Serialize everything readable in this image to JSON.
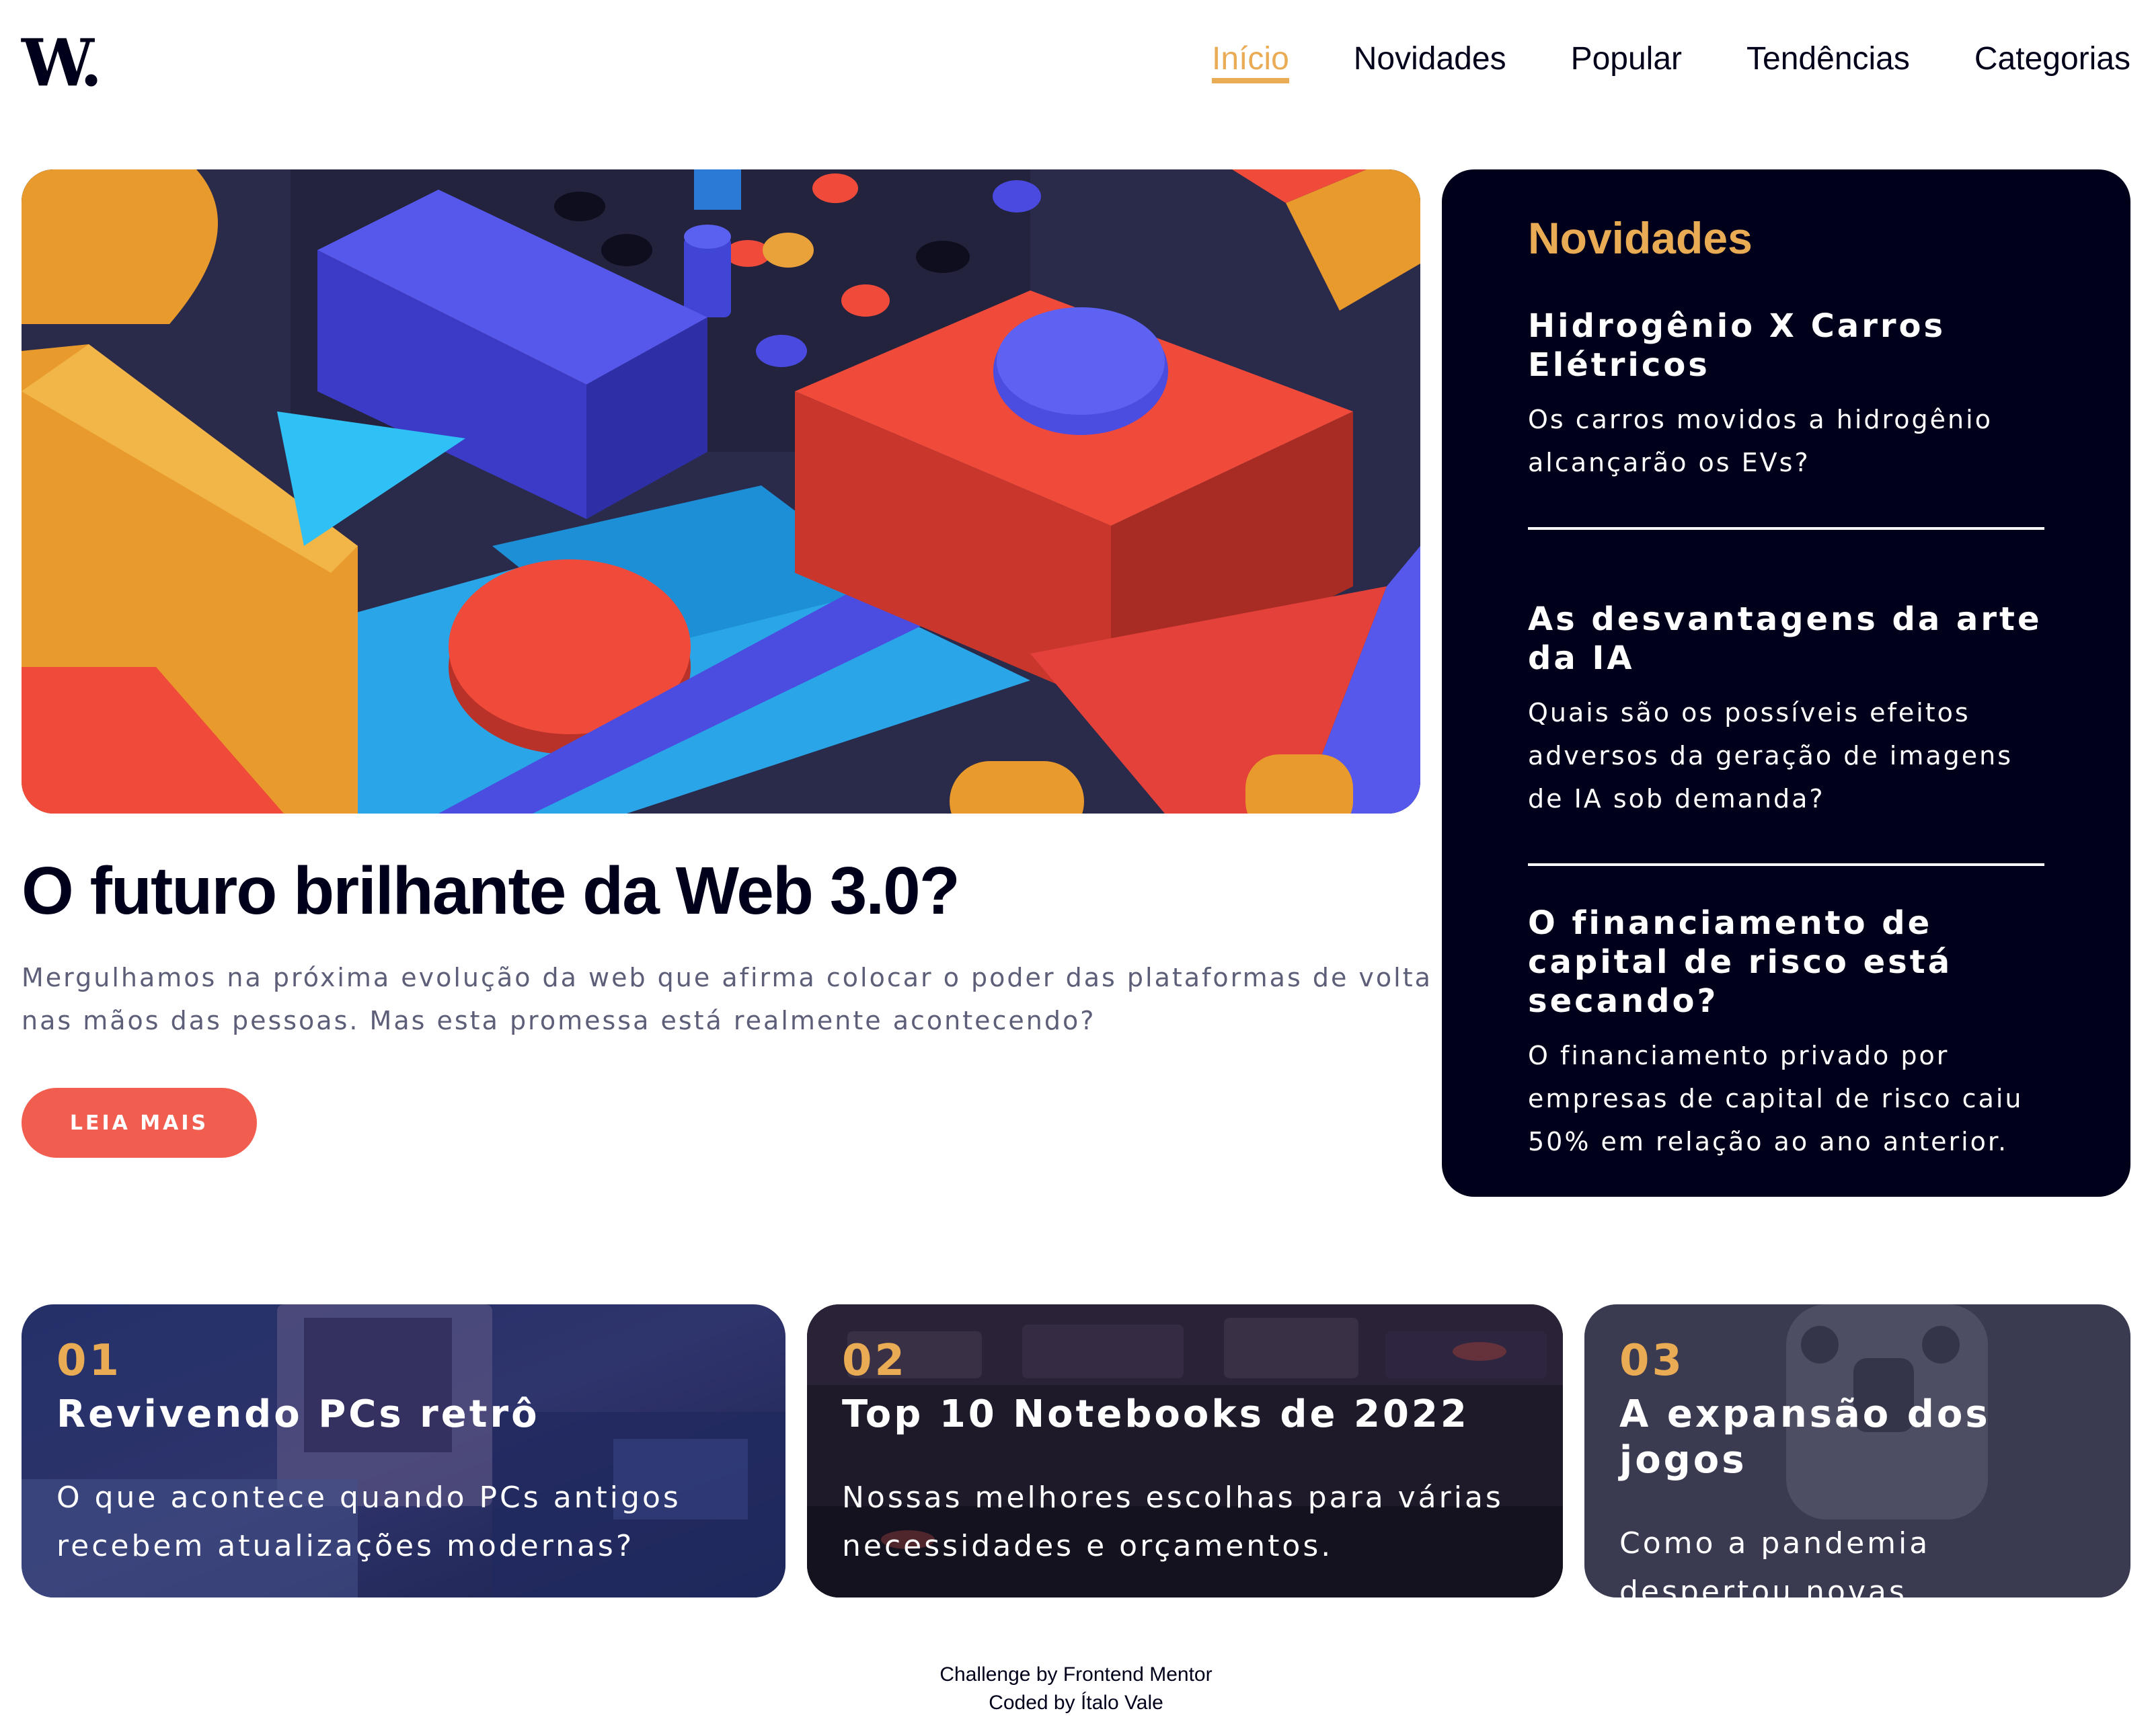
{
  "header": {
    "logo": "W.",
    "nav": [
      {
        "label": "Início",
        "active": true
      },
      {
        "label": "Novidades",
        "active": false
      },
      {
        "label": "Popular",
        "active": false
      },
      {
        "label": "Tendências",
        "active": false
      },
      {
        "label": "Categorias",
        "active": false
      }
    ]
  },
  "hero": {
    "image_subject": "abstract 3D geometric blocks",
    "title": "O futuro brilhante da Web 3.0?",
    "description": "Mergulhamos na próxima evolução da web que afirma colocar o poder das plataformas de volta nas mãos das pessoas. Mas esta promessa está realmente acontecendo?",
    "cta_label": "LEIA MAIS"
  },
  "new_panel": {
    "heading": "Novidades",
    "items": [
      {
        "title": "Hidrogênio X Carros Elétricos",
        "text": "Os carros movidos a hidrogênio alcançarão os EVs?"
      },
      {
        "title": "As desvantagens da arte da IA",
        "text": "Quais são os possíveis efeitos adversos da geração de imagens de IA sob demanda?"
      },
      {
        "title": "O financiamento de capital de risco está secando?",
        "text": "O financiamento privado por empresas de capital de risco caiu 50% em relação ao ano anterior."
      }
    ]
  },
  "cards": [
    {
      "number": "01",
      "title": "Revivendo PCs retrô",
      "text": "O que acontece quando PCs antigos recebem atualizações modernas?"
    },
    {
      "number": "02",
      "title": "Top 10 Notebooks de 2022",
      "text": "Nossas melhores escolhas para várias necessidades e orçamentos."
    },
    {
      "number": "03",
      "title": "A expansão dos jogos",
      "text": "Como a pandemia despertou novas oportunidades."
    }
  ],
  "footer": {
    "line1": "Challenge by Frontend Mentor",
    "line2": "Coded by Ítalo Vale"
  },
  "colors": {
    "accent_orange": "#e9ab53",
    "cta_red": "#f15e50",
    "dark_navy": "#00001a",
    "muted_text": "#5d5f79"
  }
}
